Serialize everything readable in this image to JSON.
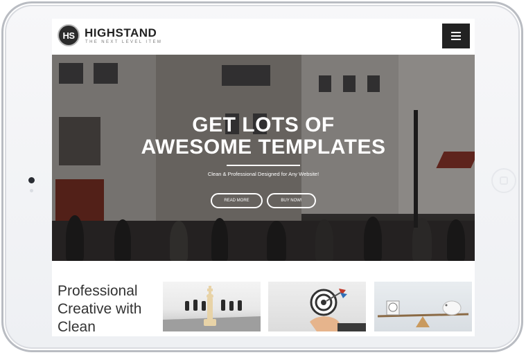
{
  "brand": {
    "logo_initials": "HS",
    "name": "HIGHSTAND",
    "tagline": "THE NEXT LEVEL ITEM"
  },
  "header": {
    "menu_icon": "hamburger-menu-icon"
  },
  "hero": {
    "title_line1": "GET LOTS OF",
    "title_line2": "AWESOME TEMPLATES",
    "subtitle": "Clean & Professional Designed for Any Website!",
    "read_more_label": "READ MORE",
    "buy_now_label": "BUY NOW!"
  },
  "content": {
    "heading_line1": "Professional",
    "heading_line2": "Creative with",
    "heading_line3": "Clean",
    "thumbnails": [
      "chess-pieces-image",
      "target-darts-image",
      "balance-scale-image"
    ]
  },
  "colors": {
    "header_button_bg": "#222222",
    "text_dark": "#333333",
    "hero_text": "#ffffff"
  }
}
